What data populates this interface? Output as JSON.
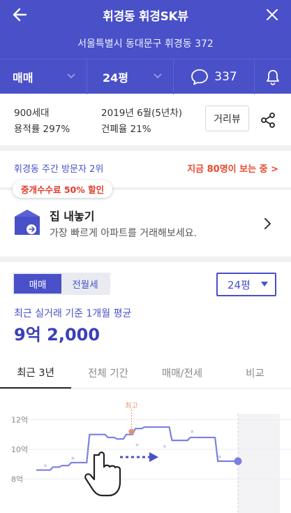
{
  "header": {
    "title": "휘경동 휘경SK뷰",
    "address": "서울특별시 동대문구 휘경동 372"
  },
  "filters": {
    "trade": "매매",
    "size": "24평",
    "comment_count": "337"
  },
  "info": {
    "households": "900세대",
    "floor_area_ratio": "용적률 297%",
    "built": "2019년 6월(5년차)",
    "building_coverage": "건폐율 21%",
    "street_view_label": "거리뷰"
  },
  "visitors": {
    "rank": "휘경동 주간 방문자 2위",
    "viewing_now": "지금 80명이 보는 중 >"
  },
  "sell": {
    "badge": "중개수수료 50% 할인",
    "title": "집 내놓기",
    "subtitle": "가장 빠르게 아파트를 거래해보세요."
  },
  "price_panel": {
    "tabs": [
      "매매",
      "전월세"
    ],
    "selected_size": "24평",
    "caption": "최근 실거래 기준 1개월 평균",
    "price": "9억 2,000"
  },
  "period_tabs": [
    "최근 3년",
    "전체 기간",
    "매매/전세",
    "비교"
  ],
  "colors": {
    "primary": "#4950c8",
    "highlight": "#e8492f",
    "peak": "#e8926b"
  },
  "chart_data": {
    "type": "line",
    "y_ticks": [
      "12억",
      "10억",
      "8억"
    ],
    "ylim": [
      7.4,
      12.4
    ],
    "peak_label": "최고",
    "series": [
      {
        "values": [
          8.6,
          8.6,
          8.8,
          8.9,
          9.1,
          9.1,
          11.0,
          11.0,
          10.8,
          10.7,
          11.0,
          11.4,
          11.5,
          11.5,
          11.5,
          10.6,
          10.6,
          10.8,
          10.8,
          10.8,
          9.2,
          9.2,
          9.2
        ]
      }
    ],
    "scatter": [
      8.9,
      9.4,
      9.0,
      10.3,
      10.2,
      11.2,
      9.5
    ],
    "peak_index": 11,
    "last_index": 22
  }
}
